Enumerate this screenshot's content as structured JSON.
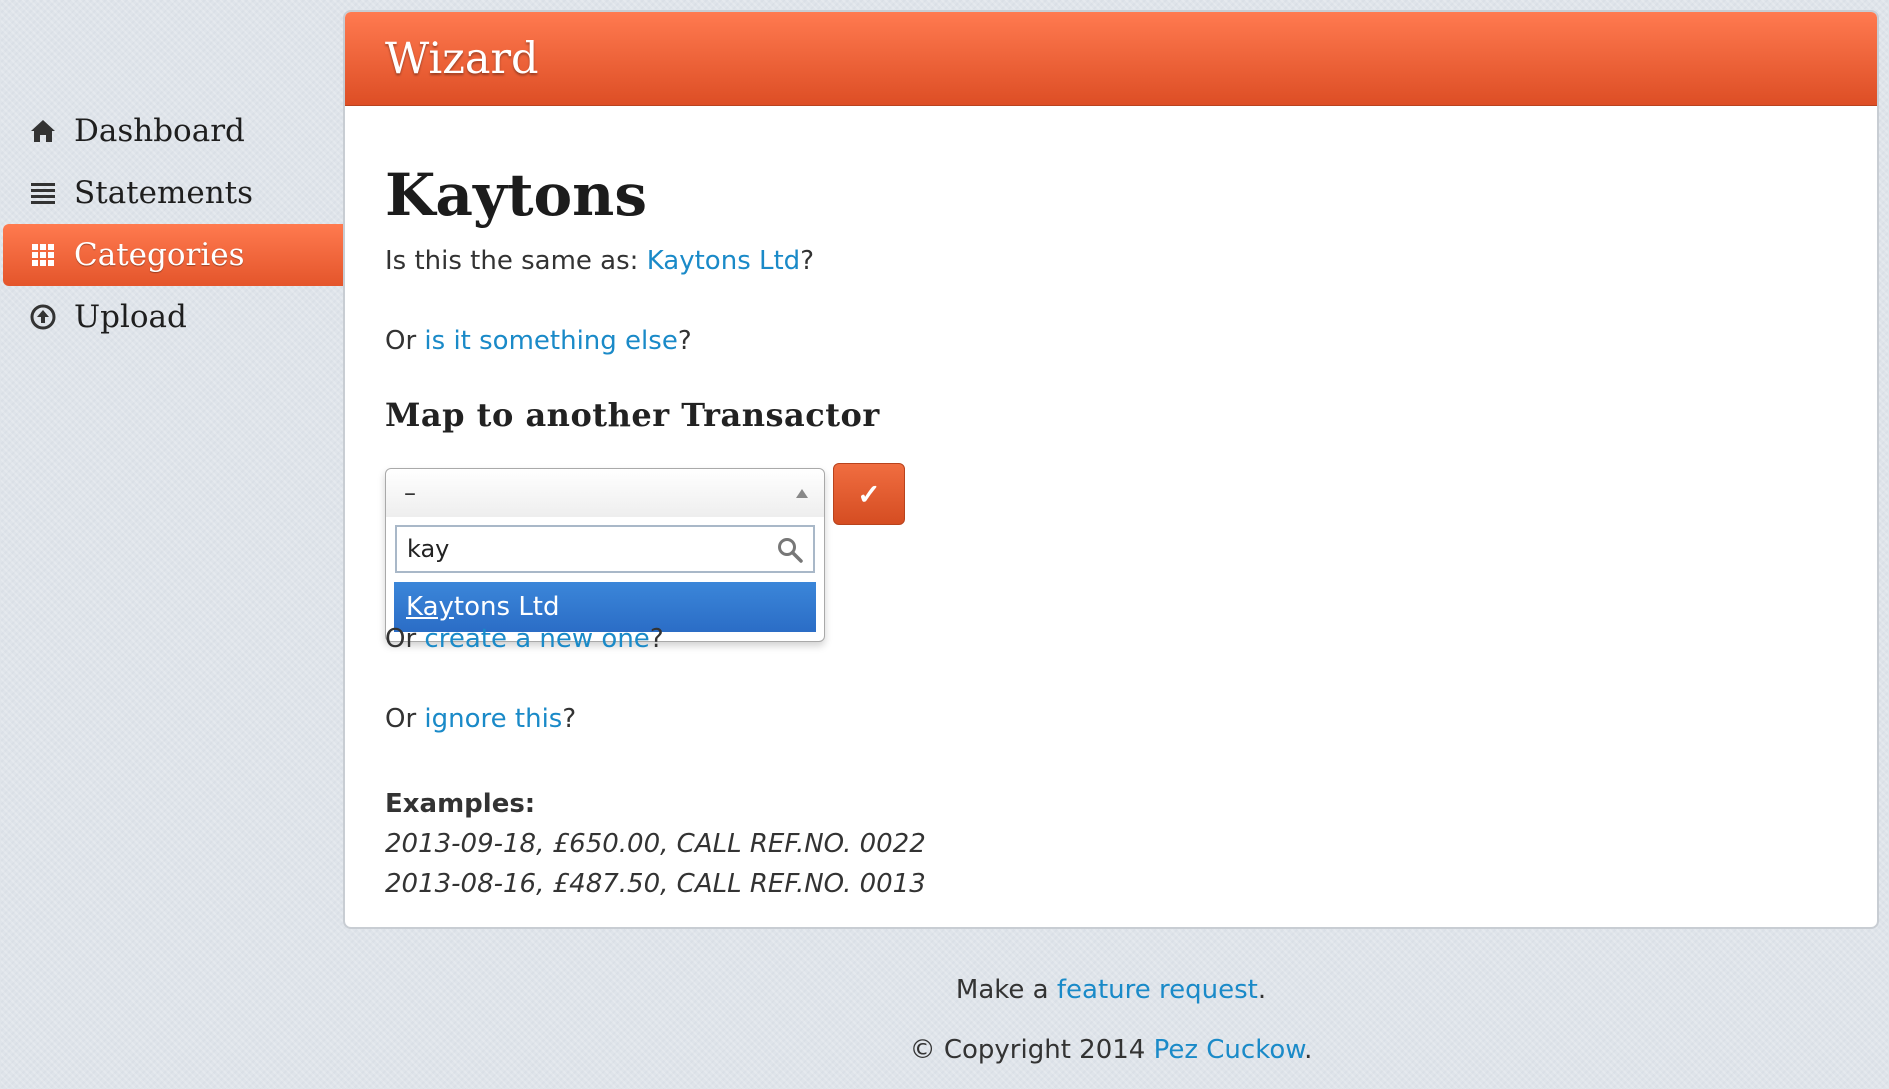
{
  "sidebar": {
    "items": [
      {
        "label": "Dashboard",
        "icon": "home-icon",
        "active": false
      },
      {
        "label": "Statements",
        "icon": "list-icon",
        "active": false
      },
      {
        "label": "Categories",
        "icon": "grid-icon",
        "active": true
      },
      {
        "label": "Upload",
        "icon": "upload-circle-icon",
        "active": false
      }
    ]
  },
  "panel": {
    "title": "Wizard"
  },
  "main": {
    "heading": "Kaytons",
    "same_as_prefix": "Is this the same as: ",
    "same_as_link": "Kaytons Ltd",
    "question_mark": "?",
    "or_prefix": "Or ",
    "something_else_link": "is it something else",
    "map_heading": "Map to another Transactor",
    "select_value": "–",
    "search_value": "kay",
    "result_match": "Kay",
    "result_rest": "tons Ltd",
    "ok_label": "✓",
    "create_link": "create a new one",
    "ignore_link": "ignore this",
    "examples_title": "Examples:",
    "examples": [
      "2013-09-18, £650.00, CALL REF.NO. 0022",
      "2013-08-16, £487.50, CALL REF.NO. 0013"
    ]
  },
  "footer": {
    "feature_prefix": "Make a ",
    "feature_link": "feature request",
    "period": ".",
    "copyright_prefix": "© Copyright 2014 ",
    "author_link": "Pez Cuckow"
  },
  "colors": {
    "accent": "#e4552b",
    "link": "#1a8ac8",
    "highlight": "#2f73cc"
  }
}
